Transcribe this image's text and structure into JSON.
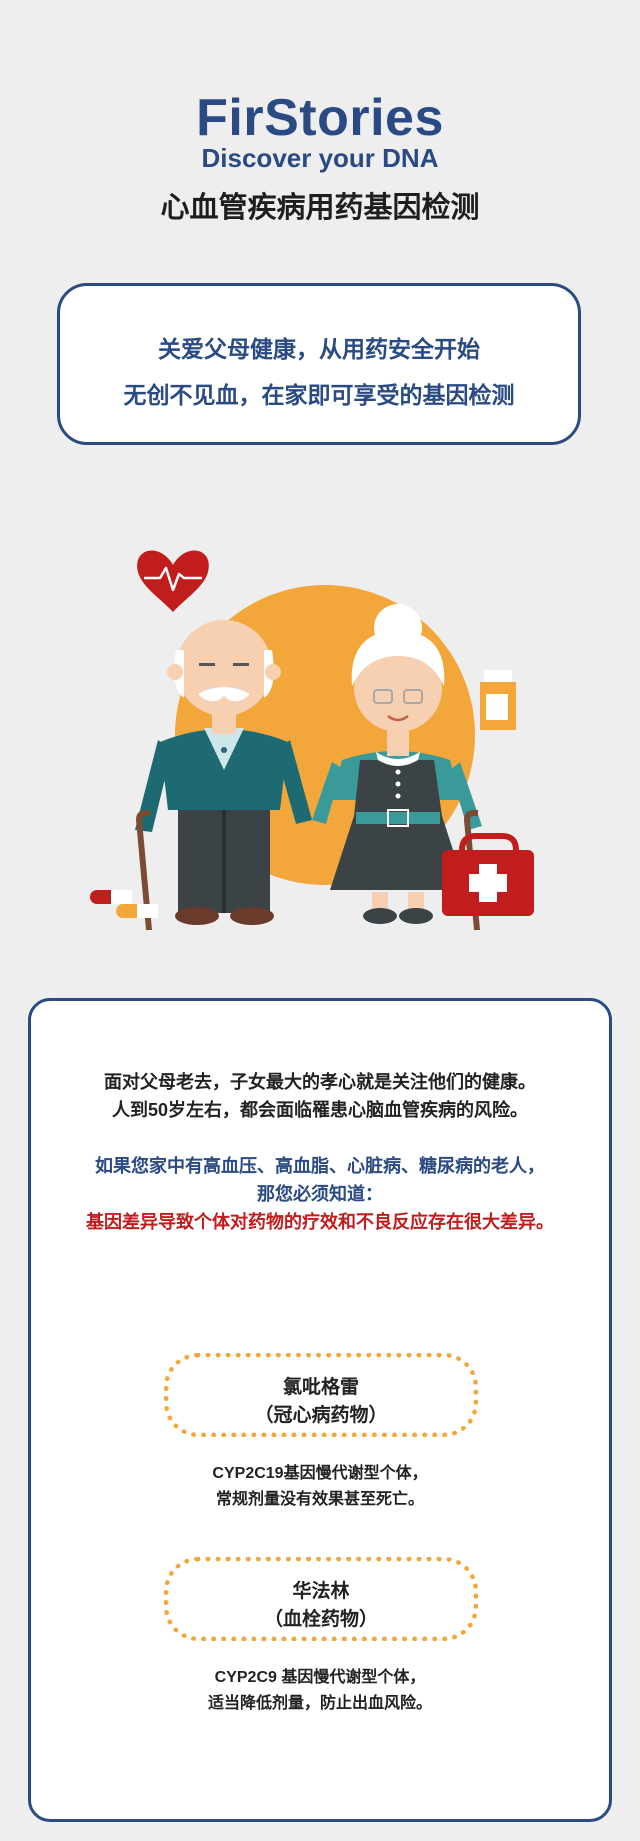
{
  "header": {
    "brand_name": "FirStories",
    "tagline": "Discover your DNA",
    "page_title": "心血管疾病用药基因检测"
  },
  "slogan": {
    "line1": "关爱父母健康，从用药安全开始",
    "line2": "无创不见血，在家即可享受的基因检测"
  },
  "intro": {
    "line1": "面对父母老去，子女最大的孝心就是关注他们的健康。",
    "line2": "人到50岁左右，都会面临罹患心脑血管疾病的风险。",
    "highlight1": "如果您家中有高血压、高血脂、心脏病、糖尿病的老人，",
    "highlight2": "那您必须知道：",
    "warning": "基因差异导致个体对药物的疗效和不良反应存在很大差异。"
  },
  "drugs": [
    {
      "name": "氯吡格雷",
      "category": "（冠心病药物）",
      "note1": "CYP2C19基因慢代谢型个体，",
      "note2": "常规剂量没有效果甚至死亡。"
    },
    {
      "name": "华法林",
      "category": "（血栓药物）",
      "note1": "CYP2C9 基因慢代谢型个体，",
      "note2": "适当降低剂量，防止出血风险。"
    }
  ],
  "colors": {
    "brand": "#2a4a84",
    "warning": "#c11d1d",
    "accent": "#f3a73a"
  }
}
